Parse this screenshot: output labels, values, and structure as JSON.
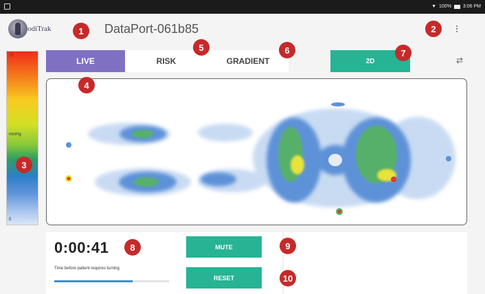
{
  "status_bar": {
    "battery": "100%",
    "time": "3:06 PM"
  },
  "app_bar": {
    "logo_text": "PodiTrak",
    "title": "DataPort-061b85"
  },
  "pressure_scale": {
    "max_label": "75",
    "unit_label": "mmHg",
    "min_label": "5"
  },
  "view_tabs": [
    {
      "label": "LIVE",
      "selected": true
    },
    {
      "label": "RISK",
      "selected": false
    },
    {
      "label": "GRADIENT",
      "selected": false
    }
  ],
  "view_toggle": {
    "label": "2D"
  },
  "timer": {
    "elapsed": "0:00:41",
    "caption": "Time before patient requires turning",
    "progress": 0.68
  },
  "actions": {
    "mute_label": "MUTE",
    "reset_label": "RESET"
  },
  "callouts": [
    "1",
    "2",
    "3",
    "4",
    "5",
    "6",
    "7",
    "8",
    "9",
    "10"
  ],
  "colors": {
    "tab_active": "#8070c2",
    "accent": "#26b494",
    "callout": "#c62a2a",
    "progress": "#3a8fd1"
  }
}
